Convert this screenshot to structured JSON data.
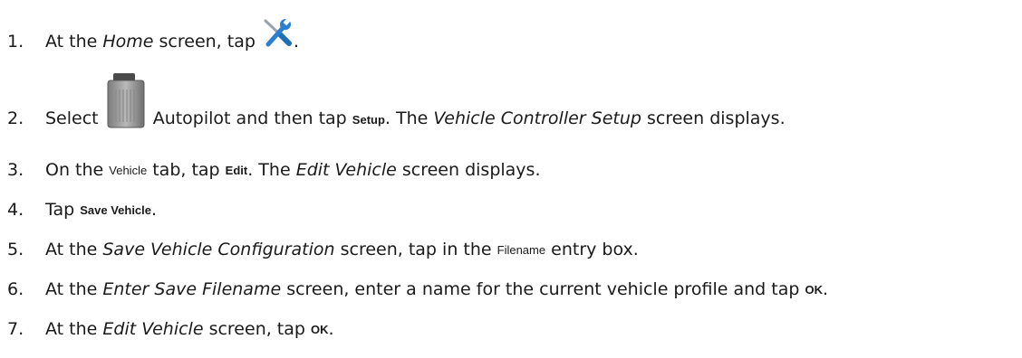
{
  "steps": [
    {
      "num": "1.",
      "a": "At the ",
      "screen": "Home",
      "b": " screen, tap ",
      "icon": "wrench-screwdriver-icon",
      "c": "."
    },
    {
      "num": "2.",
      "a": "Select ",
      "icon": "autopilot-controller-icon",
      "b": " Autopilot and then tap ",
      "btn": "Setup",
      "c": ". The ",
      "screen": "Vehicle Controller Setup",
      "d": " screen displays."
    },
    {
      "num": "3.",
      "a": "On the ",
      "tab": "Vehicle",
      "b": " tab, tap ",
      "btn": "Edit",
      "c": ". The ",
      "screen": "Edit Vehicle",
      "d": " screen displays."
    },
    {
      "num": "4.",
      "a": "Tap ",
      "btn": "Save Vehicle",
      "b": "."
    },
    {
      "num": "5.",
      "a": "At the ",
      "screen": "Save Vehicle Configuration",
      "b": " screen, tap in the ",
      "field": "Filename",
      "c": " entry box."
    },
    {
      "num": "6.",
      "a": "At the ",
      "screen": "Enter Save Filename",
      "b": " screen, enter a name for the current vehicle profile and tap ",
      "btn": "OK",
      "c": "."
    },
    {
      "num": "7.",
      "a": "At the ",
      "screen": "Edit Vehicle",
      "b": " screen, tap ",
      "btn": "OK",
      "c": "."
    }
  ]
}
